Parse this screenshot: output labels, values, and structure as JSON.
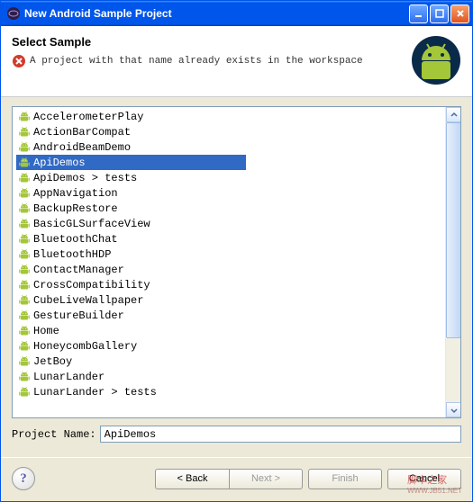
{
  "window": {
    "title": "New Android Sample Project"
  },
  "header": {
    "title": "Select Sample",
    "error_message": "A project with that name already exists in the workspace"
  },
  "samples": [
    {
      "label": "AccelerometerPlay",
      "selected": false
    },
    {
      "label": "ActionBarCompat",
      "selected": false
    },
    {
      "label": "AndroidBeamDemo",
      "selected": false
    },
    {
      "label": "ApiDemos",
      "selected": true
    },
    {
      "label": "ApiDemos > tests",
      "selected": false
    },
    {
      "label": "AppNavigation",
      "selected": false
    },
    {
      "label": "BackupRestore",
      "selected": false
    },
    {
      "label": "BasicGLSurfaceView",
      "selected": false
    },
    {
      "label": "BluetoothChat",
      "selected": false
    },
    {
      "label": "BluetoothHDP",
      "selected": false
    },
    {
      "label": "ContactManager",
      "selected": false
    },
    {
      "label": "CrossCompatibility",
      "selected": false
    },
    {
      "label": "CubeLiveWallpaper",
      "selected": false
    },
    {
      "label": "GestureBuilder",
      "selected": false
    },
    {
      "label": "Home",
      "selected": false
    },
    {
      "label": "HoneycombGallery",
      "selected": false
    },
    {
      "label": "JetBoy",
      "selected": false
    },
    {
      "label": "LunarLander",
      "selected": false
    },
    {
      "label": "LunarLander > tests",
      "selected": false
    }
  ],
  "project_name": {
    "label": "Project Name:",
    "value": "ApiDemos"
  },
  "buttons": {
    "back": "< Back",
    "next": "Next >",
    "finish": "Finish",
    "cancel": "Cancel"
  },
  "watermark": {
    "main": "脚本之家",
    "sub": "WWW.JB51.NET"
  }
}
